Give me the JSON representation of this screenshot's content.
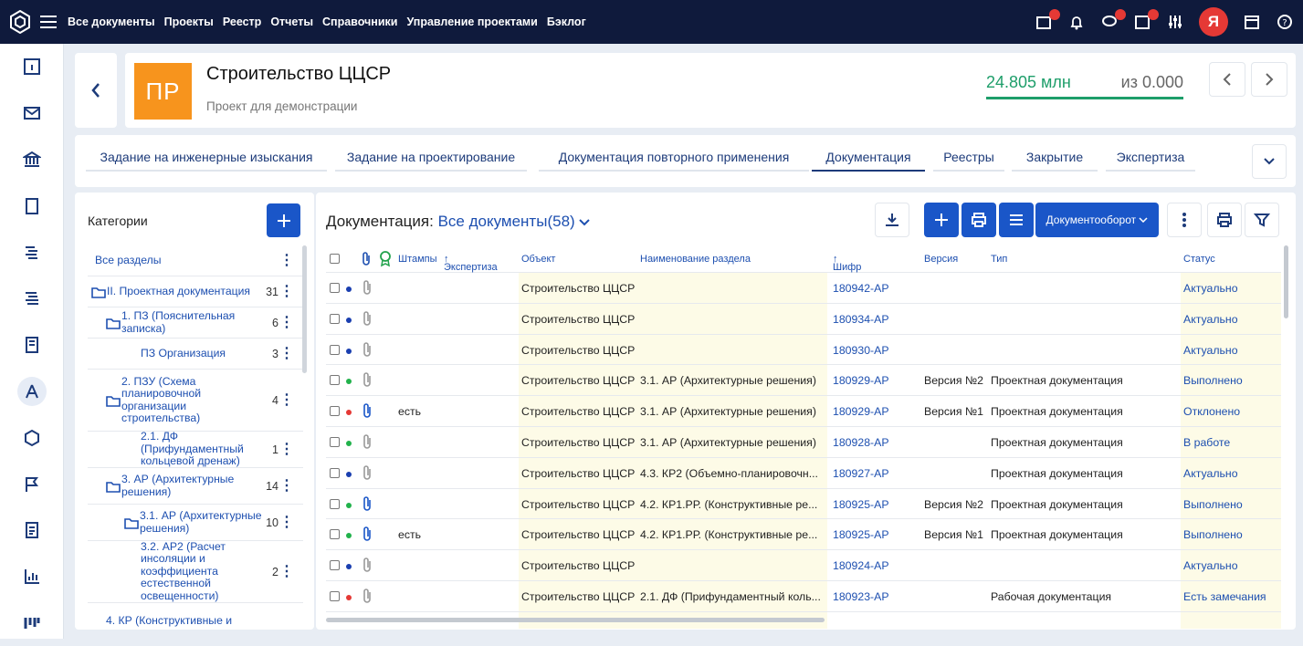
{
  "topnav": {
    "menu": [
      "Все документы",
      "Проекты",
      "Реестр",
      "Отчеты",
      "Справочники",
      "Управление проектами",
      "Бэклог"
    ],
    "avatar_letter": "Я"
  },
  "project": {
    "badge": "ПР",
    "title": "Строительство ЦЦСР",
    "subtitle": "Проект для демонстрации",
    "budget_value": "24.805 млн",
    "budget_of": "из 0.000",
    "budget_fill": 1.0
  },
  "tabs": [
    {
      "label": "Задание на инженерные изыскания",
      "active": false
    },
    {
      "label": "Задание на проектирование",
      "active": false
    },
    {
      "label": "Документация повторного применения",
      "active": false
    },
    {
      "label": "Документация",
      "active": true
    },
    {
      "label": "Реестры",
      "active": false
    },
    {
      "label": "Закрытие",
      "active": false
    },
    {
      "label": "Экспертиза",
      "active": false
    }
  ],
  "categories": {
    "title": "Категории",
    "items": [
      {
        "label": "Все разделы",
        "count": "",
        "folder": false,
        "level": 0
      },
      {
        "label": "II. Проектная документация",
        "count": "31",
        "folder": true,
        "level": 0
      },
      {
        "label": "1. ПЗ (Пояснительная записка)",
        "count": "6",
        "folder": true,
        "level": 1
      },
      {
        "label": "ПЗ Организация",
        "count": "3",
        "folder": false,
        "level": 2
      },
      {
        "label": "2. ПЗУ (Схема планировочной организации строительства)",
        "count": "4",
        "folder": true,
        "level": 1
      },
      {
        "label": "2.1. ДФ (Прифундаментный кольцевой дренаж)",
        "count": "1",
        "folder": false,
        "level": 2
      },
      {
        "label": "3. АР (Архитектурные решения)",
        "count": "14",
        "folder": true,
        "level": 1
      },
      {
        "label": "3.1. АР (Архитектурные решения)",
        "count": "10",
        "folder": true,
        "level": 2
      },
      {
        "label": "3.2. АР2 (Расчет инсоляции и коэффициента естественной освещенности)",
        "count": "2",
        "folder": false,
        "level": 2
      },
      {
        "label": "4. КР (Конструктивные и",
        "count": "",
        "folder": false,
        "level": 1
      }
    ]
  },
  "docs": {
    "title": "Документация:",
    "filter": "Все документы",
    "count": "(58)",
    "docflow_label": "Документооборот",
    "headers": {
      "stamps": "Штампы",
      "expertise": "Экспертиза",
      "object": "Объект",
      "section": "Наименование раздела",
      "code": "Шифр",
      "version": "Версия",
      "type": "Тип",
      "status": "Статус"
    },
    "rows": [
      {
        "dot": "#1a3fb0",
        "clip": "#999",
        "stamp": "",
        "object": "Строительство ЦЦСР",
        "section": "",
        "code": "180942-АР",
        "version": "",
        "type": "",
        "status": "Актуально"
      },
      {
        "dot": "#1a3fb0",
        "clip": "#999",
        "stamp": "",
        "object": "Строительство ЦЦСР",
        "section": "",
        "code": "180934-АР",
        "version": "",
        "type": "",
        "status": "Актуально"
      },
      {
        "dot": "#1a3fb0",
        "clip": "#999",
        "stamp": "",
        "object": "Строительство ЦЦСР",
        "section": "",
        "code": "180930-АР",
        "version": "",
        "type": "",
        "status": "Актуально"
      },
      {
        "dot": "#22b24c",
        "clip": "#999",
        "stamp": "",
        "object": "Строительство ЦЦСР",
        "section": "3.1. АР (Архитектурные решения)",
        "code": "180929-АР",
        "version": "Версия №2",
        "type": "Проектная документация",
        "status": "Выполнено"
      },
      {
        "dot": "#e53935",
        "clip": "#1a56c8",
        "stamp": "есть",
        "object": "Строительство ЦЦСР",
        "section": "3.1. АР (Архитектурные решения)",
        "code": "180929-АР",
        "version": "Версия №1",
        "type": "Проектная документация",
        "status": "Отклонено"
      },
      {
        "dot": "#22b24c",
        "clip": "#999",
        "stamp": "",
        "object": "Строительство ЦЦСР",
        "section": "3.1. АР (Архитектурные решения)",
        "code": "180928-АР",
        "version": "",
        "type": "Проектная документация",
        "status": "В работе"
      },
      {
        "dot": "#1a3fb0",
        "clip": "#999",
        "stamp": "",
        "object": "Строительство ЦЦСР",
        "section": "4.3. КР2 (Объемно-планировочн...",
        "code": "180927-АР",
        "version": "",
        "type": "Проектная документация",
        "status": "Актуально"
      },
      {
        "dot": "#22b24c",
        "clip": "#1a56c8",
        "stamp": "",
        "object": "Строительство ЦЦСР",
        "section": "4.2. КР1.РР. (Конструктивные ре...",
        "code": "180925-АР",
        "version": "Версия №2",
        "type": "Проектная документация",
        "status": "Выполнено"
      },
      {
        "dot": "#22b24c",
        "clip": "#1a56c8",
        "stamp": "есть",
        "object": "Строительство ЦЦСР",
        "section": "4.2. КР1.РР. (Конструктивные ре...",
        "code": "180925-АР",
        "version": "Версия №1",
        "type": "Проектная документация",
        "status": "Выполнено"
      },
      {
        "dot": "#1a3fb0",
        "clip": "#999",
        "stamp": "",
        "object": "Строительство ЦЦСР",
        "section": "",
        "code": "180924-АР",
        "version": "",
        "type": "",
        "status": "Актуально"
      },
      {
        "dot": "#e53935",
        "clip": "#999",
        "stamp": "",
        "object": "Строительство ЦЦСР",
        "section": "2.1. ДФ (Прифундаментный коль...",
        "code": "180923-АР",
        "version": "",
        "type": "Рабочая документация",
        "status": "Есть замечания"
      }
    ]
  }
}
